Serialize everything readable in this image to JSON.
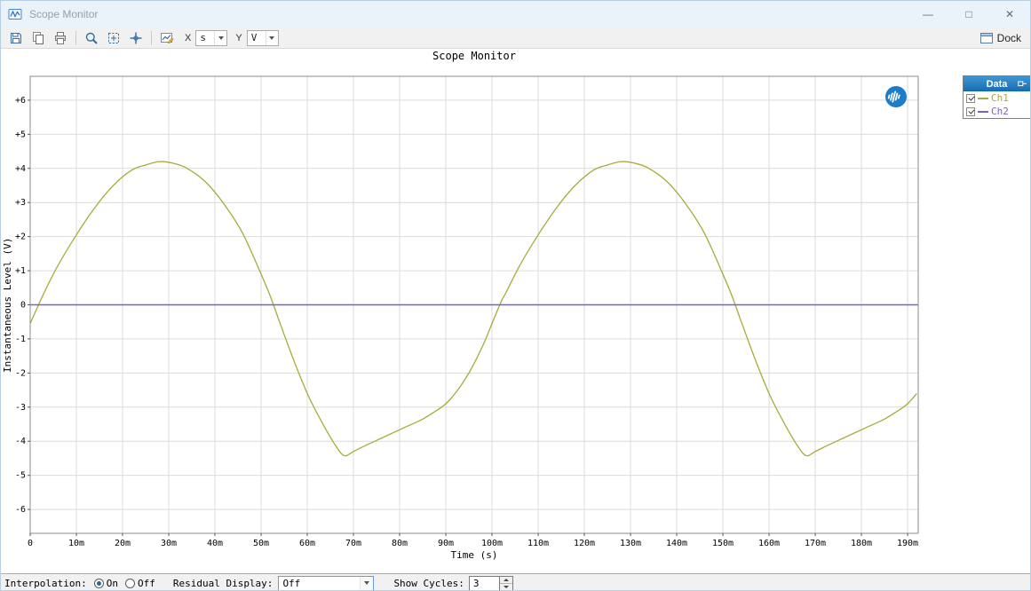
{
  "window": {
    "title": "Scope Monitor",
    "controls": {
      "minimize": "—",
      "maximize": "□",
      "close": "✕"
    }
  },
  "toolbar": {
    "x_label": "X",
    "x_unit": "s",
    "y_label": "Y",
    "y_unit": "V",
    "dock_label": "Dock"
  },
  "legend": {
    "header": "Data",
    "items": [
      {
        "label": "Ch1",
        "color": "#a8aa3c",
        "checked": true
      },
      {
        "label": "Ch2",
        "color": "#7d5fc8",
        "checked": true
      }
    ]
  },
  "controls": {
    "interpolation_label": "Interpolation:",
    "interpolation_options": [
      "On",
      "Off"
    ],
    "interpolation_selected": "On",
    "residual_label": "Residual Display:",
    "residual_value": "Off",
    "show_cycles_label": "Show Cycles:",
    "show_cycles_value": "3"
  },
  "chart_data": {
    "type": "line",
    "title": "Scope Monitor",
    "xlabel": "Time (s)",
    "ylabel": "Instantaneous Level (V)",
    "x_unit": "s",
    "y_unit": "V",
    "xlim_ms": [
      0,
      192.3
    ],
    "ylim": [
      -6.7,
      6.7
    ],
    "grid": true,
    "grid_color": "#dcdcdc",
    "legend_position": "right-outside",
    "x_tick_values_ms": [
      0,
      10,
      20,
      30,
      40,
      50,
      60,
      70,
      80,
      90,
      100,
      110,
      120,
      130,
      140,
      150,
      160,
      170,
      180,
      190
    ],
    "x_tick_labels": [
      "0",
      "10m",
      "20m",
      "30m",
      "40m",
      "50m",
      "60m",
      "70m",
      "80m",
      "90m",
      "100m",
      "110m",
      "120m",
      "130m",
      "140m",
      "150m",
      "160m",
      "170m",
      "180m",
      "190m"
    ],
    "y_tick_values": [
      6,
      5,
      4,
      3,
      2,
      1,
      0,
      -1,
      -2,
      -3,
      -4,
      -5,
      -6
    ],
    "y_tick_labels": [
      "+6",
      "+5",
      "+4",
      "+3",
      "+2",
      "+1",
      "0",
      "-1",
      "-2",
      "-3",
      "-4",
      "-5",
      "-6"
    ],
    "series": [
      {
        "name": "Ch1",
        "color": "#a8aa3c",
        "width": 1.3,
        "x_ms": [
          0,
          3,
          6,
          10,
          14,
          18,
          22,
          25,
          28,
          31,
          34,
          38,
          42,
          46,
          50,
          52,
          54,
          57,
          60,
          63,
          66,
          68,
          70,
          73,
          77,
          81,
          85,
          88,
          90,
          92,
          95,
          98,
          100,
          102,
          103,
          106,
          110,
          114,
          118,
          122,
          125,
          128,
          131,
          134,
          138,
          142,
          146,
          150,
          152,
          154,
          157,
          160,
          163,
          166,
          168,
          170,
          173,
          177,
          181,
          185,
          188,
          190,
          192
        ],
        "y": [
          -0.55,
          0.35,
          1.15,
          2.05,
          2.85,
          3.5,
          3.95,
          4.1,
          4.2,
          4.15,
          4.0,
          3.6,
          2.95,
          2.1,
          0.9,
          0.25,
          -0.5,
          -1.6,
          -2.6,
          -3.4,
          -4.1,
          -4.42,
          -4.3,
          -4.1,
          -3.85,
          -3.6,
          -3.35,
          -3.1,
          -2.9,
          -2.6,
          -2.0,
          -1.2,
          -0.55,
          0.1,
          0.35,
          1.15,
          2.05,
          2.85,
          3.5,
          3.95,
          4.1,
          4.2,
          4.15,
          4.0,
          3.6,
          2.95,
          2.1,
          0.9,
          0.25,
          -0.5,
          -1.6,
          -2.6,
          -3.4,
          -4.1,
          -4.42,
          -4.3,
          -4.1,
          -3.85,
          -3.6,
          -3.35,
          -3.1,
          -2.9,
          -2.6
        ]
      },
      {
        "name": "Ch2",
        "color": "#7d5fc8",
        "width": 1.6,
        "x_ms": [
          0,
          192.3
        ],
        "y": [
          0,
          0
        ]
      }
    ]
  }
}
